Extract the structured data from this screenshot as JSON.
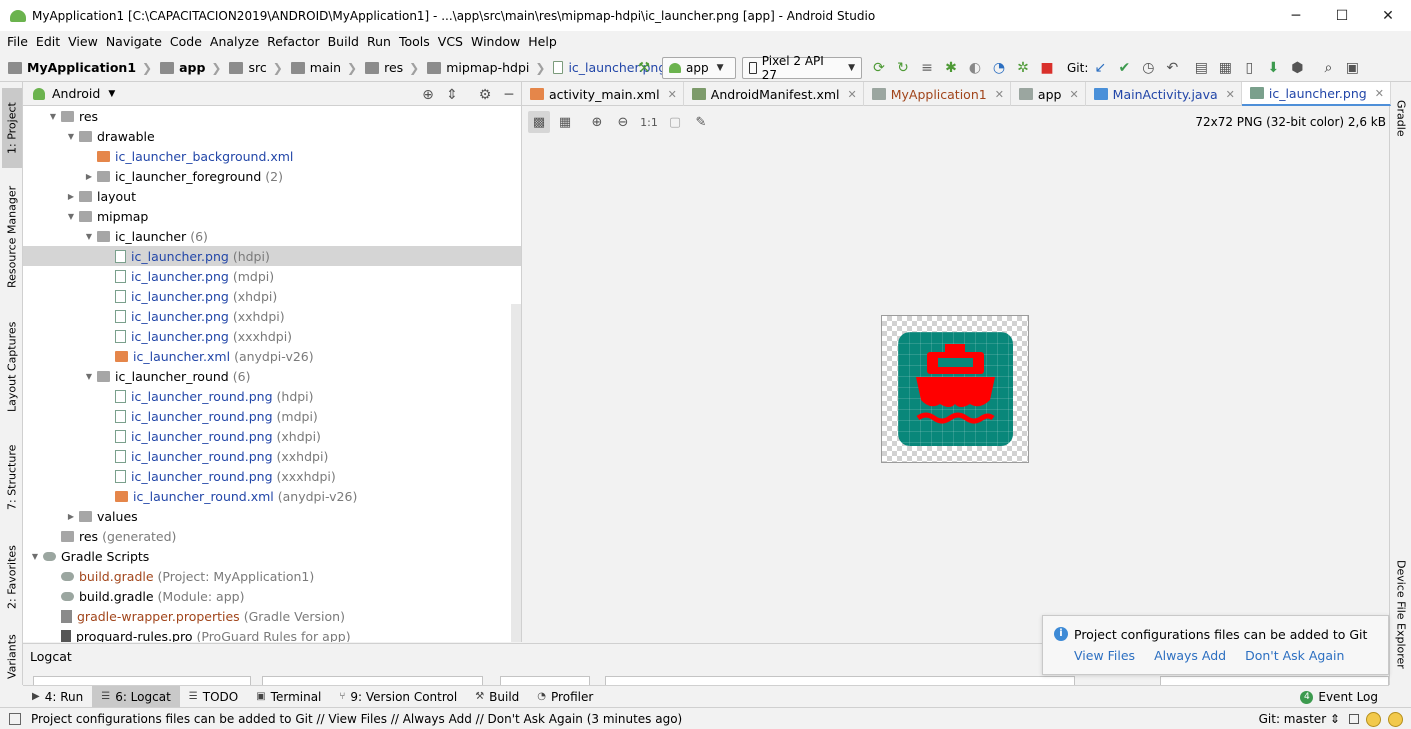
{
  "window": {
    "title": "MyApplication1 [C:\\CAPACITACION2019\\ANDROID\\MyApplication1] - ...\\app\\src\\main\\res\\mipmap-hdpi\\ic_launcher.png [app] - Android Studio",
    "minimize": "─",
    "maximize": "☐",
    "close": "✕"
  },
  "menu": [
    "File",
    "Edit",
    "View",
    "Navigate",
    "Code",
    "Analyze",
    "Refactor",
    "Build",
    "Run",
    "Tools",
    "VCS",
    "Window",
    "Help"
  ],
  "breadcrumbs": [
    "MyApplication1",
    "app",
    "src",
    "main",
    "res",
    "mipmap-hdpi",
    "ic_launcher.png"
  ],
  "toolbar": {
    "run_config": "app",
    "device": "Pixel 2 API 27",
    "git_label": "Git:"
  },
  "project_panel": {
    "view_name": "Android",
    "tree": [
      {
        "label": "res",
        "extra": "",
        "indent": 1,
        "twisty": "▼",
        "icon": "folder",
        "color": ""
      },
      {
        "label": "drawable",
        "extra": "",
        "indent": 2,
        "twisty": "▼",
        "icon": "folder",
        "color": ""
      },
      {
        "label": "ic_launcher_background.xml",
        "extra": "",
        "indent": 3,
        "twisty": "",
        "icon": "xml",
        "color": "blue"
      },
      {
        "label": "ic_launcher_foreground",
        "extra": "(2)",
        "indent": 3,
        "twisty": "▶",
        "icon": "folder",
        "color": ""
      },
      {
        "label": "layout",
        "extra": "",
        "indent": 2,
        "twisty": "▶",
        "icon": "folder",
        "color": ""
      },
      {
        "label": "mipmap",
        "extra": "",
        "indent": 2,
        "twisty": "▼",
        "icon": "folder",
        "color": ""
      },
      {
        "label": "ic_launcher",
        "extra": "(6)",
        "indent": 3,
        "twisty": "▼",
        "icon": "folder",
        "color": ""
      },
      {
        "label": "ic_launcher.png",
        "extra": "(hdpi)",
        "indent": 4,
        "twisty": "",
        "icon": "png",
        "color": "blue",
        "selected": true
      },
      {
        "label": "ic_launcher.png",
        "extra": "(mdpi)",
        "indent": 4,
        "twisty": "",
        "icon": "png",
        "color": "blue"
      },
      {
        "label": "ic_launcher.png",
        "extra": "(xhdpi)",
        "indent": 4,
        "twisty": "",
        "icon": "png",
        "color": "blue"
      },
      {
        "label": "ic_launcher.png",
        "extra": "(xxhdpi)",
        "indent": 4,
        "twisty": "",
        "icon": "png",
        "color": "blue"
      },
      {
        "label": "ic_launcher.png",
        "extra": "(xxxhdpi)",
        "indent": 4,
        "twisty": "",
        "icon": "png",
        "color": "blue"
      },
      {
        "label": "ic_launcher.xml",
        "extra": "(anydpi-v26)",
        "indent": 4,
        "twisty": "",
        "icon": "xml",
        "color": "blue"
      },
      {
        "label": "ic_launcher_round",
        "extra": "(6)",
        "indent": 3,
        "twisty": "▼",
        "icon": "folder",
        "color": ""
      },
      {
        "label": "ic_launcher_round.png",
        "extra": "(hdpi)",
        "indent": 4,
        "twisty": "",
        "icon": "png",
        "color": "blue"
      },
      {
        "label": "ic_launcher_round.png",
        "extra": "(mdpi)",
        "indent": 4,
        "twisty": "",
        "icon": "png",
        "color": "blue"
      },
      {
        "label": "ic_launcher_round.png",
        "extra": "(xhdpi)",
        "indent": 4,
        "twisty": "",
        "icon": "png",
        "color": "blue"
      },
      {
        "label": "ic_launcher_round.png",
        "extra": "(xxhdpi)",
        "indent": 4,
        "twisty": "",
        "icon": "png",
        "color": "blue"
      },
      {
        "label": "ic_launcher_round.png",
        "extra": "(xxxhdpi)",
        "indent": 4,
        "twisty": "",
        "icon": "png",
        "color": "blue"
      },
      {
        "label": "ic_launcher_round.xml",
        "extra": "(anydpi-v26)",
        "indent": 4,
        "twisty": "",
        "icon": "xml",
        "color": "blue"
      },
      {
        "label": "values",
        "extra": "",
        "indent": 2,
        "twisty": "▶",
        "icon": "folder",
        "color": ""
      },
      {
        "label": "res",
        "extra": "(generated)",
        "indent": 1,
        "twisty": "",
        "icon": "folder",
        "color": ""
      },
      {
        "label": "Gradle Scripts",
        "extra": "",
        "indent": 0,
        "twisty": "▼",
        "icon": "gradle",
        "color": ""
      },
      {
        "label": "build.gradle",
        "extra": "(Project: MyApplication1)",
        "indent": 1,
        "twisty": "",
        "icon": "gradle",
        "color": "orange"
      },
      {
        "label": "build.gradle",
        "extra": "(Module: app)",
        "indent": 1,
        "twisty": "",
        "icon": "gradle",
        "color": ""
      },
      {
        "label": "gradle-wrapper.properties",
        "extra": "(Gradle Version)",
        "indent": 1,
        "twisty": "",
        "icon": "props",
        "color": "orange"
      },
      {
        "label": "proguard-rules.pro",
        "extra": "(ProGuard Rules for app)",
        "indent": 1,
        "twisty": "",
        "icon": "pro",
        "color": ""
      }
    ]
  },
  "editor_tabs": [
    {
      "label": "activity_main.xml",
      "icon_color": "#e5864a",
      "color": "",
      "active": false
    },
    {
      "label": "AndroidManifest.xml",
      "icon_color": "#7d9b6b",
      "color": "",
      "active": false
    },
    {
      "label": "MyApplication1",
      "icon_color": "#9ba6a0",
      "color": "orange",
      "active": false
    },
    {
      "label": "app",
      "icon_color": "#9ba6a0",
      "color": "",
      "active": false
    },
    {
      "label": "MainActivity.java",
      "icon_color": "#4a90d9",
      "color": "blue",
      "active": false
    },
    {
      "label": "ic_launcher.png",
      "icon_color": "#7aa08c",
      "color": "blue",
      "active": true
    }
  ],
  "image_editor": {
    "info": "72x72 PNG (32-bit color) 2,6 kB",
    "actual_size_label": "1:1"
  },
  "left_tabs": {
    "project": "1: Project",
    "resource_manager": "Resource Manager",
    "layout_captures": "Layout Captures",
    "structure": "7: Structure",
    "favorites": "2: Favorites",
    "variants": "Variants"
  },
  "right_tabs": {
    "gradle": "Gradle",
    "device_file_explorer": "Device File Explorer"
  },
  "logcat": {
    "title": "Logcat"
  },
  "notification": {
    "message": "Project configurations files can be added to Git",
    "actions": [
      "View Files",
      "Always Add",
      "Don't Ask Again"
    ]
  },
  "bottom_tabs": [
    {
      "label": "4: Run",
      "icon": "▶",
      "active": false
    },
    {
      "label": "6: Logcat",
      "icon": "☰",
      "active": true
    },
    {
      "label": "TODO",
      "icon": "☰",
      "active": false
    },
    {
      "label": "Terminal",
      "icon": "▣",
      "active": false
    },
    {
      "label": "9: Version Control",
      "icon": "⑂",
      "active": false
    },
    {
      "label": "Build",
      "icon": "⚒",
      "active": false
    },
    {
      "label": "Profiler",
      "icon": "◔",
      "active": false
    }
  ],
  "event_log": {
    "count": "4",
    "label": "Event Log"
  },
  "status": {
    "message": "Project configurations files can be added to Git // View Files // Always Add // Don't Ask Again (3 minutes ago)",
    "git_branch": "Git: master ⇕"
  },
  "colors": {
    "selection": "#d5d5d5",
    "link_blue": "#2246a8",
    "modified_orange": "#a1451b",
    "icon_teal": "#09877a",
    "ship_red": "#ff0000"
  }
}
